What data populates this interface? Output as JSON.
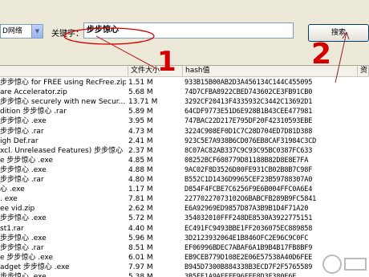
{
  "toolbar": {
    "network_select_value": "D网络",
    "keyword_label": "关键字：",
    "keyword_value": "步步惊心",
    "search_button_label": "搜索"
  },
  "list": {
    "columns": [
      "",
      "文件大小",
      "hash值",
      "资"
    ],
    "rows": [
      {
        "name": "步步惊心 for FREE using RecFree.zip",
        "size": "1.51 M",
        "hash": "933B15B00AB2D3A456134C144C455095"
      },
      {
        "name": "are Accelerator.zip",
        "size": "5.68 M",
        "hash": "74D7CFBA8922CBED743602CE3FB91CB0"
      },
      {
        "name": "步步惊心 securely with new Secur...",
        "size": "13.71 M",
        "hash": "3292CF20413F4335932C3442C13692D1"
      },
      {
        "name": "dition 步步惊心 .rar",
        "size": "5.89 M",
        "hash": "64CDF9773E51D6E928B1B43CEE477981"
      },
      {
        "name": "步步惊心 .exe",
        "size": "3.95 M",
        "hash": "747BAC22D217E795DF20F42310593EBE"
      },
      {
        "name": "步步惊心 .rar",
        "size": "4.73 M",
        "hash": "3224C908EF0D1C7C28D704ED7D81D388"
      },
      {
        "name": "igh Def.rar",
        "size": "2.41 M",
        "hash": "923C5E7A938B6CD076EB8CAF31984C3CD"
      },
      {
        "name": "xcl. Unreleased Features) 步步惊心 .exe",
        "size": "2.37 M",
        "hash": "8C07AC82AB337C9C93C95BC0387FC633"
      },
      {
        "name": "e 步步惊心 .exe",
        "size": "4.85 M",
        "hash": "08252BCF608779D81188B82D8E8E7FA"
      },
      {
        "name": "步步惊心 .exe",
        "size": "4.88 M",
        "hash": "9AC02F8D3526D80FE931CB02B8B7C98F"
      },
      {
        "name": "步步惊心 .rar",
        "size": "4.80 M",
        "hash": "B552C1D1436D9965CEF23B59788307A0"
      },
      {
        "name": "心 .exe",
        "size": "1.17 M",
        "hash": "D854F4FCBE7C6256F9E6B004FFC0A6E4"
      },
      {
        "name": ". exe",
        "size": "7.81 M",
        "hash": "22770227073102O6BABCFB289B9FC5841"
      },
      {
        "name": "ee vid.zip",
        "size": "2.62 M",
        "hash": "E6A92969ED9857D87A3B9B1D4F71A20"
      },
      {
        "name": "步步惊心 .exe",
        "size": "5.72 M",
        "hash": "354032010FFF248DE8530A3922775151"
      },
      {
        "name": "st1.rar",
        "size": "4.40 M",
        "hash": "EC491FC9493BBE1FF2036075EC889858"
      },
      {
        "name": "步步惊心 .exe",
        "size": "5.96 M",
        "hash": "3D2123932064E1B846OFC2E96C9C0FC"
      },
      {
        "name": "步步惊心 .rar",
        "size": "8.51 M",
        "hash": "EF06996BDEC7ABAF6A1B9B4B17FB8BF9"
      },
      {
        "name": "e 步步惊心 .exe",
        "size": "6.01 M",
        "hash": "EB9CEB779D108E2E06E57538A40D6FEE"
      },
      {
        "name": "adget 步步惊心 .exe",
        "size": "7.97 M",
        "hash": "B945D7300B884338B3ECD7F2F5765589"
      },
      {
        "name": "步步惊心 .exe",
        "size": "5.38 M",
        "hash": "3B5FE1A9AEEFE96FEE8D3F380E6E..."
      }
    ]
  },
  "annotations": {
    "marker_1": "1",
    "marker_2": "2"
  },
  "colors": {
    "annotation_red": "#d40000",
    "window_bg": "#ece9d8",
    "input_border": "#7f9db9"
  }
}
